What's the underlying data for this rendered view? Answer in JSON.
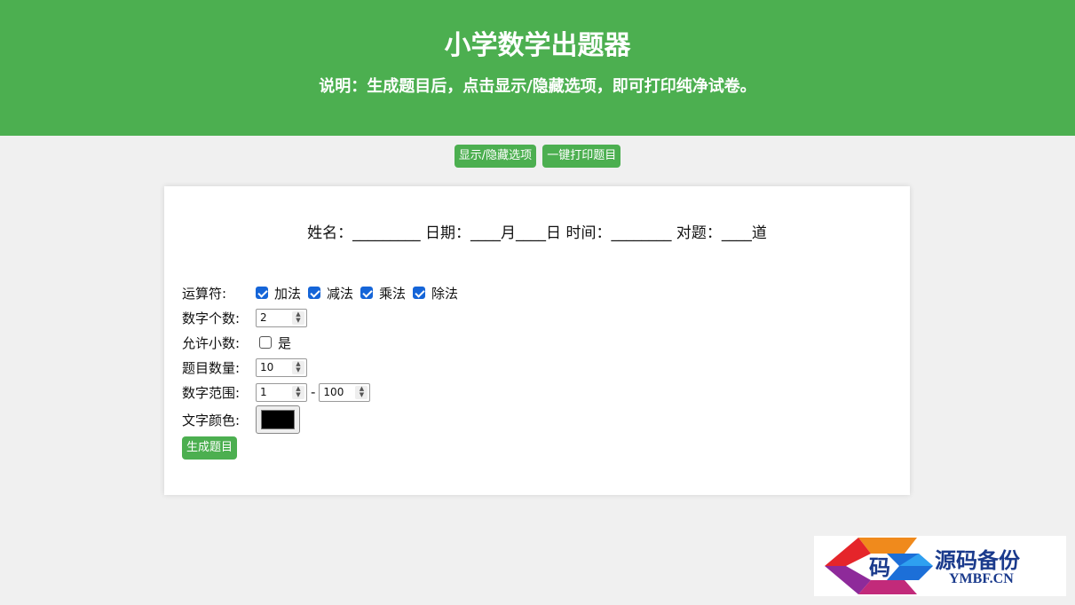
{
  "header": {
    "title": "小学数学出题器",
    "subtitle": "说明：生成题目后，点击显示/隐藏选项，即可打印纯净试卷。"
  },
  "toolbar": {
    "toggle_label": "显示/隐藏选项",
    "print_label": "一键打印题目"
  },
  "info_line": "姓名：_________ 日期：____月____日 时间：________ 对题：____道",
  "options": {
    "operators_label": "运算符:",
    "operators": [
      {
        "label": "加法",
        "checked": true
      },
      {
        "label": "减法",
        "checked": true
      },
      {
        "label": "乘法",
        "checked": true
      },
      {
        "label": "除法",
        "checked": true
      }
    ],
    "digit_count_label": "数字个数:",
    "digit_count_value": "2",
    "decimals_label": "允许小数:",
    "decimals_option": "是",
    "decimals_checked": false,
    "question_count_label": "题目数量:",
    "question_count_value": "10",
    "range_label": "数字范围:",
    "range_min": "1",
    "range_sep": "-",
    "range_max": "100",
    "color_label": "文字颜色:",
    "color_value": "#000000",
    "generate_label": "生成题目"
  },
  "watermark": {
    "glyph": "码",
    "name": "源码备份",
    "domain": "YMBF.CN"
  },
  "colors": {
    "accent": "#4caf50",
    "checkbox": "#1565d8",
    "background": "#f0f0f0"
  }
}
